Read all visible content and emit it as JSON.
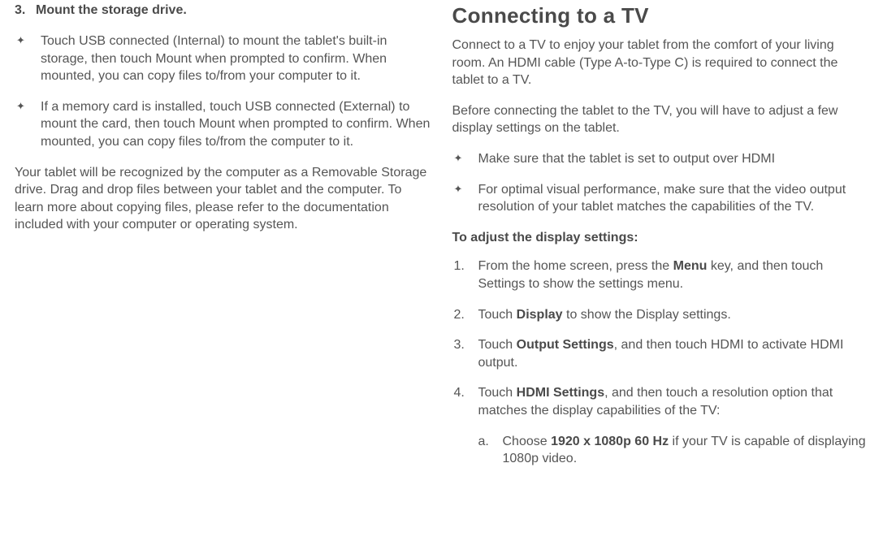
{
  "left": {
    "step_num": "3.",
    "step_title": "Mount the storage drive.",
    "bullets": [
      "Touch USB connected (Internal) to mount the tablet's built-in storage, then touch Mount when prompted to confirm. When mounted, you can copy files to/from your computer to it.",
      "If a memory card is installed, touch USB connected (External) to mount the card, then touch Mount when prompted to confirm. When mounted, you can copy files to/from the computer to it."
    ],
    "para": "Your tablet will be recognized by the computer as a Removable Storage drive. Drag and drop files between your tablet and the computer. To learn more about copying files, please refer to the documentation included with your computer or operating system."
  },
  "right": {
    "heading": "Connecting to a TV",
    "para1": "Connect to a TV to enjoy your tablet from the comfort of your living room. An HDMI cable (Type A-to-Type C) is required to connect the tablet to a TV.",
    "para2": "Before connecting the tablet to the TV, you will have to adjust a few display settings on the tablet.",
    "bullets": [
      "Make sure that the tablet is set to output over HDMI",
      "For optimal visual performance, make sure that the video output resolution of your tablet matches the capabilities of the TV."
    ],
    "sub_heading": "To adjust the display settings:",
    "steps": {
      "s1a": "From the home screen, press the ",
      "s1b": "Menu",
      "s1c": " key, and then touch Settings to show the settings menu.",
      "s2a": "Touch ",
      "s2b": "Display",
      "s2c": " to show the Display settings.",
      "s3a": "Touch ",
      "s3b": "Output Settings",
      "s3c": ", and then touch HDMI to activate HDMI output.",
      "s4a": "Touch ",
      "s4b": "HDMI Settings",
      "s4c": ", and then touch a resolution option that matches the display capabilities of the TV:",
      "sub_letter": "a.",
      "sub_a1": "Choose ",
      "sub_a2": "1920 x 1080p 60 Hz",
      "sub_a3": " if your TV is capable of displaying 1080p video."
    }
  }
}
